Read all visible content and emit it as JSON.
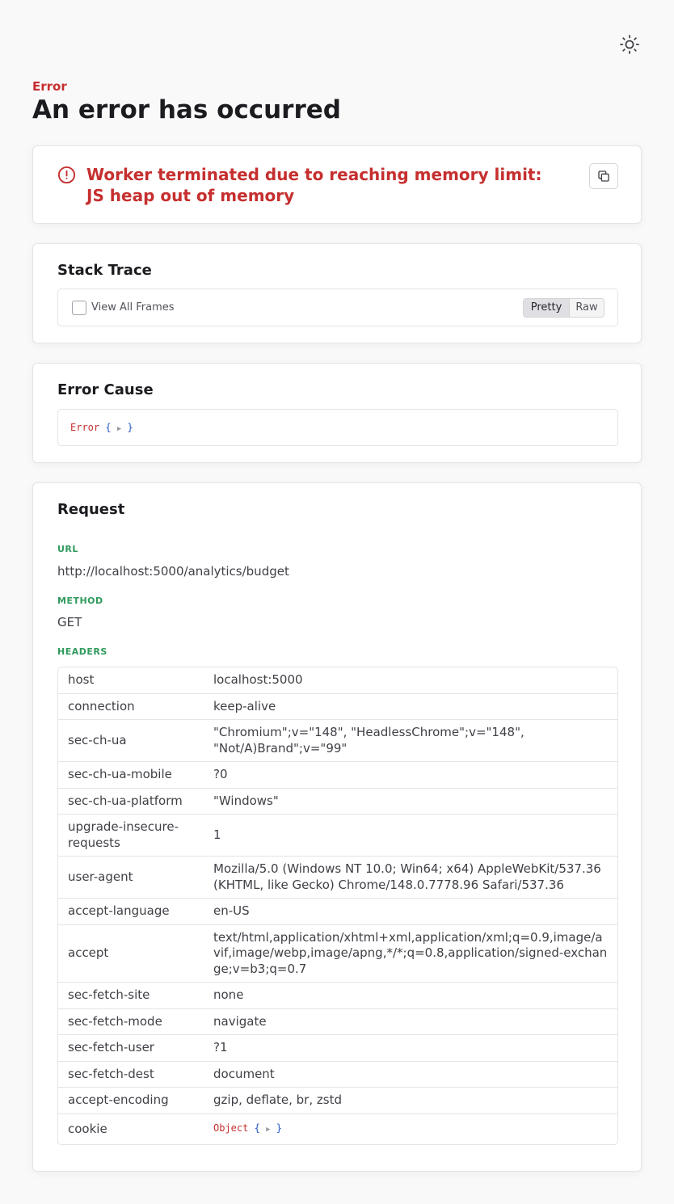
{
  "theme_toggle": {
    "icon": "sun-icon"
  },
  "header": {
    "eyebrow": "Error",
    "title": "An error has occurred"
  },
  "error_message": {
    "icon": "alert-circle-icon",
    "text": "Worker terminated due to reaching memory limit: JS heap out of memory",
    "copy_icon": "copy-icon"
  },
  "stack_trace": {
    "title": "Stack Trace",
    "view_all_label": "View All Frames",
    "view_all_checked": false,
    "modes": [
      "Pretty",
      "Raw"
    ],
    "active_mode": "Pretty"
  },
  "error_cause": {
    "title": "Error Cause",
    "name": "Error",
    "open_brace": "{",
    "arrow": "▶",
    "close_brace": "}"
  },
  "request": {
    "title": "Request",
    "url_label": "URL",
    "url": "http://localhost:5000/analytics/budget",
    "method_label": "METHOD",
    "method": "GET",
    "headers_label": "HEADERS",
    "headers": [
      {
        "key": "host",
        "value": "localhost:5000"
      },
      {
        "key": "connection",
        "value": "keep-alive"
      },
      {
        "key": "sec-ch-ua",
        "value": "\"Chromium\";v=\"148\", \"HeadlessChrome\";v=\"148\", \"Not/A)Brand\";v=\"99\""
      },
      {
        "key": "sec-ch-ua-mobile",
        "value": "?0"
      },
      {
        "key": "sec-ch-ua-platform",
        "value": "\"Windows\""
      },
      {
        "key": "upgrade-insecure-requests",
        "value": "1"
      },
      {
        "key": "user-agent",
        "value": "Mozilla/5.0 (Windows NT 10.0; Win64; x64) AppleWebKit/537.36 (KHTML, like Gecko) Chrome/148.0.7778.96 Safari/537.36"
      },
      {
        "key": "accept-language",
        "value": "en-US"
      },
      {
        "key": "accept",
        "value": "text/html,application/xhtml+xml,application/xml;q=0.9,image/avif,image/webp,image/apng,*/*;q=0.8,application/signed-exchange;v=b3;q=0.7"
      },
      {
        "key": "sec-fetch-site",
        "value": "none"
      },
      {
        "key": "sec-fetch-mode",
        "value": "navigate"
      },
      {
        "key": "sec-fetch-user",
        "value": "?1"
      },
      {
        "key": "sec-fetch-dest",
        "value": "document"
      },
      {
        "key": "accept-encoding",
        "value": "gzip, deflate, br, zstd"
      }
    ],
    "cookie": {
      "key": "cookie",
      "name": "Object",
      "open_brace": "{",
      "arrow": "▶",
      "close_brace": "}"
    }
  }
}
